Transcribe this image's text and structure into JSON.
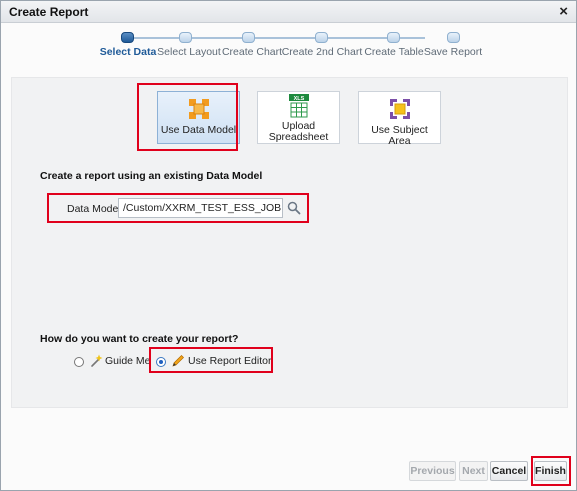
{
  "dialog": {
    "title": "Create Report",
    "close_glyph": "×"
  },
  "steps": [
    {
      "label": "Select Data",
      "active": true
    },
    {
      "label": "Select Layout",
      "active": false
    },
    {
      "label": "Create Chart",
      "active": false
    },
    {
      "label": "Create 2nd Chart",
      "active": false
    },
    {
      "label": "Create Table",
      "active": false
    },
    {
      "label": "Save Report",
      "active": false
    }
  ],
  "sources": [
    {
      "label": "Use Data Model",
      "icon": "data-model-icon",
      "selected": true
    },
    {
      "label_line1": "Upload",
      "label_line2": "Spreadsheet",
      "icon": "spreadsheet-icon",
      "icon_badge": "XLS",
      "selected": false
    },
    {
      "label": "Use Subject Area",
      "icon": "subject-area-icon",
      "selected": false
    }
  ],
  "data_model": {
    "heading": "Create a report using an existing Data Model",
    "label": "Data Model",
    "value": "/Custom/XXRM_TEST_ESS_JOB.xdm"
  },
  "create_mode": {
    "question": "How do you want to create your report?",
    "options": [
      {
        "label": "Guide Me",
        "icon": "wand-icon",
        "selected": false
      },
      {
        "label": "Use Report Editor",
        "icon": "pencil-icon",
        "selected": true
      }
    ]
  },
  "footer": {
    "previous_label": "Previous",
    "next_label": "Next",
    "cancel_label": "Cancel",
    "finish_label": "Finish"
  },
  "colors": {
    "highlight": "#e0001b",
    "accent": "#1f5a98",
    "active_step": "#1f5a98"
  }
}
